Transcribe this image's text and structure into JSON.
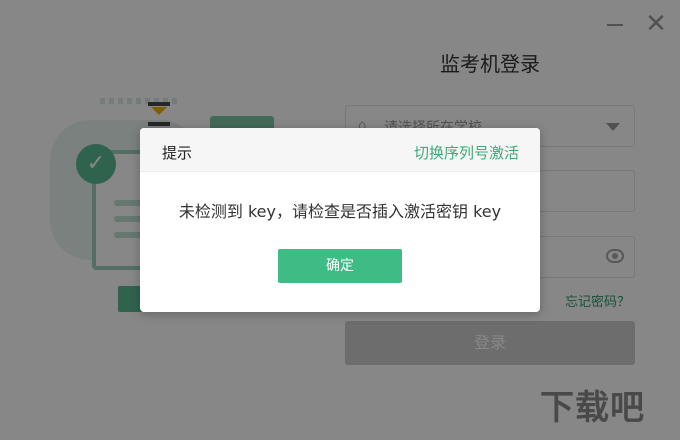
{
  "window": {
    "login_title": "监考机登录",
    "school_placeholder": "请选择所在学校",
    "account_placeholder": "",
    "password_placeholder": "",
    "forgot_password": "忘记密码？",
    "login_button": "登录",
    "watermark": "下载吧"
  },
  "dialog": {
    "title": "提示",
    "switch_link": "切换序列号激活",
    "message": "未检测到 key，请检查是否插入激活密钥 key",
    "ok_button": "确定"
  },
  "colors": {
    "accent": "#3fbc86",
    "link": "#3eaa78",
    "overlay": "rgba(0,0,0,0.47)"
  },
  "icons": {
    "minimize": "minimize-icon",
    "close": "close-icon",
    "school": "school-icon",
    "dropdown": "chevron-down-icon",
    "password_visibility": "eye-icon"
  }
}
